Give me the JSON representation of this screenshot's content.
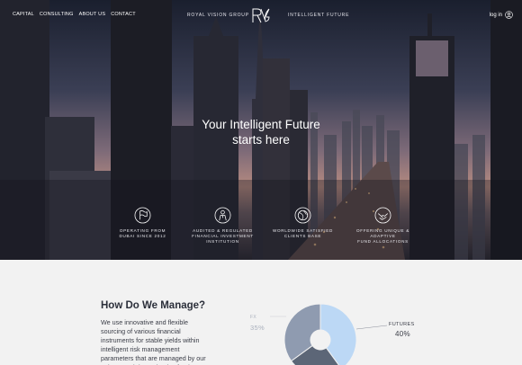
{
  "nav": {
    "links": [
      "CAPITAL",
      "CONSULTING",
      "ABOUT US",
      "CONTACT"
    ],
    "brand_left": "ROYAL VISION GROUP",
    "brand_right": "INTELLIGENT FUTURE",
    "logo_text": "RVG",
    "login": "log in"
  },
  "hero": {
    "title_line1": "Your Intelligent Future",
    "title_line2": "starts here"
  },
  "features": [
    {
      "icon": "flag-icon",
      "line1": "OPERATING FROM",
      "line2": "DUBAI SINCE 2012"
    },
    {
      "icon": "person-icon",
      "line1": "AUDITED & REGULATED",
      "line2": "FINANCIAL INVESTMENT",
      "line3": "INSTITUTION"
    },
    {
      "icon": "globe-icon",
      "line1": "WORLDWIDE SATISFIED",
      "line2": "CLIENTS BASE"
    },
    {
      "icon": "handshake-icon",
      "line1": "OFFERING UNIQUE &",
      "line2": "ADAPTIVE",
      "line3": "FUND ALLOCATIONS"
    }
  ],
  "manage": {
    "title": "How Do We Manage?",
    "body": "We use innovative and flexible sourcing of various financial instruments for stable yields within intelligent risk management parameters that are managed by our unique, real-time adaptive fund"
  },
  "allocation": {
    "fx_label": "FX",
    "fx_value": "35%",
    "futures_label": "FUTURES",
    "futures_value": "40%",
    "colors": {
      "futures": "#bcd8f5",
      "fx": "#8f9bb0",
      "other": "#5c6677"
    }
  }
}
